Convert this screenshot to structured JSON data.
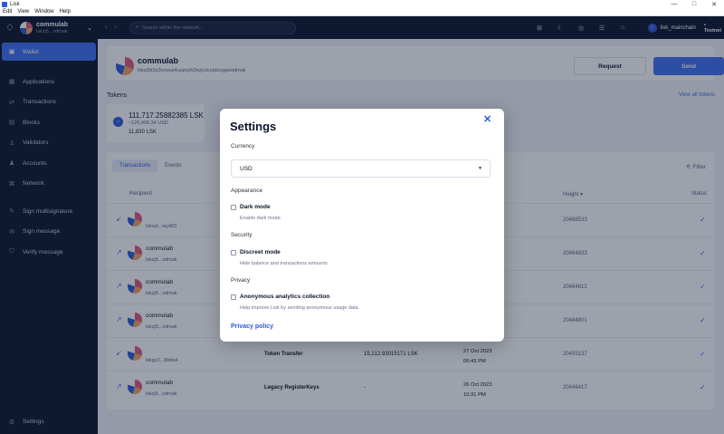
{
  "window": {
    "title": "Lisk",
    "menu": [
      "Edit",
      "View",
      "Window",
      "Help"
    ],
    "controls": {
      "minimize": "—",
      "maximize": "□",
      "close": "✕"
    }
  },
  "sidebar": {
    "account": {
      "name": "commulab",
      "address": "lskzj5...vdmak"
    },
    "items": [
      {
        "label": "Wallet",
        "icon": "wallet-icon",
        "glyph": "▣"
      },
      {
        "label": "Applications",
        "icon": "applications-icon",
        "glyph": "▦"
      },
      {
        "label": "Transactions",
        "icon": "transactions-icon",
        "glyph": "⇄"
      },
      {
        "label": "Blocks",
        "icon": "blocks-icon",
        "glyph": "▤"
      },
      {
        "label": "Validators",
        "icon": "validators-icon",
        "glyph": "♙"
      },
      {
        "label": "Accounts",
        "icon": "accounts-icon",
        "glyph": "♟"
      },
      {
        "label": "Network",
        "icon": "network-icon",
        "glyph": "⌘"
      },
      {
        "label": "Sign multisignature",
        "icon": "sign-multisig-icon",
        "glyph": "✎"
      },
      {
        "label": "Sign message",
        "icon": "sign-message-icon",
        "glyph": "✉"
      },
      {
        "label": "Verify message",
        "icon": "verify-message-icon",
        "glyph": "⛉"
      }
    ],
    "settings": {
      "label": "Settings",
      "glyph": "⚙"
    }
  },
  "header": {
    "search_placeholder": "Search within the network...",
    "chain_name": "lisk_mainchain",
    "network": "• Testnet"
  },
  "account_card": {
    "name": "commulab",
    "address": "lskzj5k2p3cnuup4uupvyh3xvjcoccatozggewdmak",
    "request_label": "Request",
    "send_label": "Send"
  },
  "tokens": {
    "label": "Tokens",
    "view_all": "View all tokens",
    "card": {
      "amount": "111,717.25882385 LSK",
      "usd": "~126,409.34 USD",
      "locked": "11,830 LSK"
    }
  },
  "table": {
    "tabs": [
      "Transactions",
      "Events"
    ],
    "filter_label": "Filter",
    "headers": {
      "recipient": "Recipient",
      "height": "Height ▾",
      "status": "Status"
    },
    "rows": [
      {
        "name": "",
        "address": "lskvyt...wyd63",
        "type": "",
        "amount": "",
        "date": "",
        "time": "",
        "height": "20488533",
        "direction": "↙"
      },
      {
        "name": "commulab",
        "address": "lskzj5...vdmak",
        "type": "",
        "amount": "",
        "date": "",
        "time": "",
        "height": "20484833",
        "direction": "↗"
      },
      {
        "name": "commulab",
        "address": "lskzj5...vdmak",
        "type": "",
        "amount": "",
        "date": "",
        "time": "",
        "height": "20484812",
        "direction": "↗"
      },
      {
        "name": "commulab",
        "address": "lskzj5...vdmak",
        "type": "",
        "amount": "",
        "date": "",
        "time": "",
        "height": "20484801",
        "direction": "↗"
      },
      {
        "name": "",
        "address": "lskgc2...8bda4",
        "type": "Token Transfer",
        "amount": "15,212.93015171 LSK",
        "date": "27 Oct 2023",
        "time": "06:43 PM",
        "height": "20455137",
        "direction": "↙"
      },
      {
        "name": "commulab",
        "address": "lskzj5...vdmak",
        "type": "Legacy RegisterKeys",
        "amount": "-",
        "date": "26 Oct 2023",
        "time": "10:31 PM",
        "height": "20446417",
        "direction": "↗"
      }
    ]
  },
  "settings_modal": {
    "title": "Settings",
    "close": "✕",
    "currency": {
      "label": "Currency",
      "value": "USD"
    },
    "appearance": {
      "label": "Appearance",
      "option": "Dark mode",
      "desc": "Enable dark mode."
    },
    "security": {
      "label": "Security",
      "option": "Discreet mode",
      "desc": "Hide balance and transactions amounts."
    },
    "privacy": {
      "label": "Privacy",
      "option": "Anonymous analytics collection",
      "desc": "Help improve Lisk by sending anonymous usage data."
    },
    "privacy_policy": "Privacy policy"
  }
}
